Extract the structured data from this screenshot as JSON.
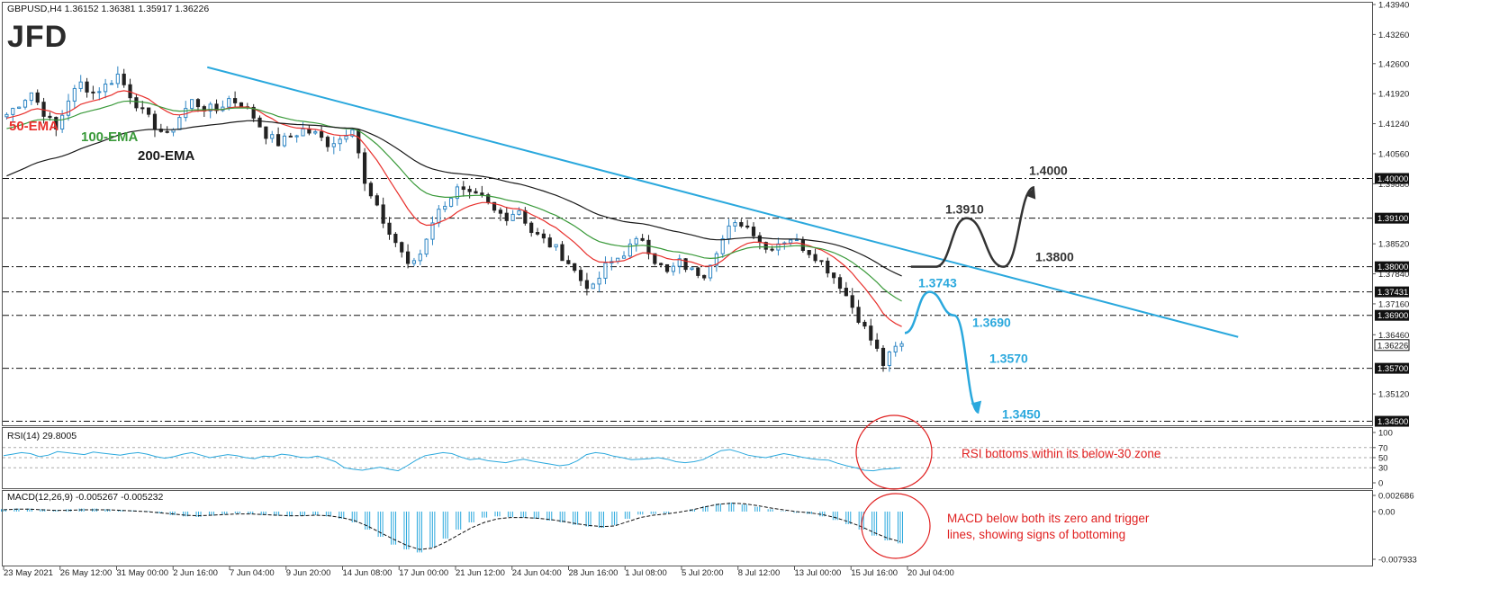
{
  "header": {
    "symbol_info": "GBPUSD,H4  1.36152 1.36381 1.35917 1.36226",
    "logo": "JFD"
  },
  "colors": {
    "bull_candle": "#2f86c4",
    "bear_candle": "#222222",
    "ema50": "#e8302c",
    "ema100": "#3a9a3a",
    "ema200": "#1a1a1a",
    "trendline": "#2aa8dd",
    "level_line": "#111111",
    "scenario_up": "#333333",
    "scenario_down": "#2aa8dd",
    "annotation": "#e02020",
    "rsi_line": "#2aa8dd",
    "macd_hist": "#2aa8dd",
    "macd_signal": "#111111"
  },
  "chart_data": [
    {
      "panel": "price",
      "type": "candlestick",
      "title": "GBPUSD,H4",
      "ylim": [
        1.3445,
        1.4394
      ],
      "price_scale_ticks": [
        "1.43940",
        "1.43260",
        "1.42600",
        "1.41920",
        "1.41240",
        "1.40560",
        "1.39880",
        "1.38520",
        "1.37840",
        "1.37160",
        "1.36460",
        "1.35120"
      ],
      "x_tick_labels": [
        "23 May 2021",
        "26 May 12:00",
        "31 May 00:00",
        "2 Jun 16:00",
        "7 Jun 04:00",
        "9 Jun 20:00",
        "14 Jun 08:00",
        "17 Jun 00:00",
        "21 Jun 12:00",
        "24 Jun 04:00",
        "28 Jun 16:00",
        "1 Jul 08:00",
        "5 Jul 20:00",
        "8 Jul 12:00",
        "13 Jul 00:00",
        "15 Jul 16:00",
        "20 Jul 04:00"
      ],
      "levels": [
        {
          "value": 1.4,
          "axis_label": "1.40000",
          "chart_label": "1.4000"
        },
        {
          "value": 1.391,
          "axis_label": "1.39100",
          "chart_label": "1.3910"
        },
        {
          "value": 1.38,
          "axis_label": "1.38000",
          "chart_label": "1.3800"
        },
        {
          "value": 1.37431,
          "axis_label": "1.37431",
          "chart_label": "1.3743"
        },
        {
          "value": 1.369,
          "axis_label": "1.36900",
          "chart_label": "1.3690"
        },
        {
          "value": 1.357,
          "axis_label": "1.35700",
          "chart_label": "1.3570"
        },
        {
          "value": 1.345,
          "axis_label": "1.34500",
          "chart_label": "1.3450"
        }
      ],
      "current_price": {
        "value": 1.36226,
        "label": "1.36226"
      },
      "ema_labels": {
        "ema50": "50-EMA",
        "ema100": "100-EMA",
        "ema200": "200-EMA"
      },
      "close_path": [
        [
          0,
          1.4145
        ],
        [
          2,
          1.417
        ],
        [
          4,
          1.4195
        ],
        [
          6,
          1.415
        ],
        [
          8,
          1.411
        ],
        [
          10,
          1.418
        ],
        [
          12,
          1.4215
        ],
        [
          14,
          1.4195
        ],
        [
          16,
          1.421
        ],
        [
          18,
          1.4235
        ],
        [
          20,
          1.419
        ],
        [
          22,
          1.415
        ],
        [
          24,
          1.412
        ],
        [
          26,
          1.4095
        ],
        [
          28,
          1.414
        ],
        [
          30,
          1.4175
        ],
        [
          32,
          1.416
        ],
        [
          34,
          1.4155
        ],
        [
          36,
          1.418
        ],
        [
          38,
          1.417
        ],
        [
          40,
          1.414
        ],
        [
          42,
          1.41
        ],
        [
          44,
          1.408
        ],
        [
          46,
          1.4095
        ],
        [
          48,
          1.411
        ],
        [
          50,
          1.41
        ],
        [
          52,
          1.408
        ],
        [
          54,
          1.409
        ],
        [
          56,
          1.412
        ],
        [
          57,
          1.406
        ],
        [
          58,
          1.3985
        ],
        [
          60,
          1.393
        ],
        [
          62,
          1.3875
        ],
        [
          64,
          1.3835
        ],
        [
          65,
          1.38
        ],
        [
          67,
          1.383
        ],
        [
          69,
          1.3905
        ],
        [
          71,
          1.3945
        ],
        [
          73,
          1.3975
        ],
        [
          75,
          1.396
        ],
        [
          77,
          1.3955
        ],
        [
          79,
          1.3925
        ],
        [
          81,
          1.3915
        ],
        [
          83,
          1.393
        ],
        [
          85,
          1.388
        ],
        [
          87,
          1.386
        ],
        [
          89,
          1.384
        ],
        [
          91,
          1.381
        ],
        [
          93,
          1.377
        ],
        [
          95,
          1.375
        ],
        [
          97,
          1.38
        ],
        [
          99,
          1.382
        ],
        [
          101,
          1.3845
        ],
        [
          103,
          1.3865
        ],
        [
          105,
          1.3815
        ],
        [
          107,
          1.3785
        ],
        [
          109,
          1.381
        ],
        [
          111,
          1.379
        ],
        [
          113,
          1.3785
        ],
        [
          115,
          1.384
        ],
        [
          117,
          1.3885
        ],
        [
          119,
          1.39
        ],
        [
          121,
          1.388
        ],
        [
          123,
          1.384
        ],
        [
          125,
          1.3855
        ],
        [
          127,
          1.3865
        ],
        [
          129,
          1.3845
        ],
        [
          131,
          1.3825
        ],
        [
          133,
          1.3795
        ],
        [
          135,
          1.376
        ],
        [
          137,
          1.371
        ],
        [
          139,
          1.366
        ],
        [
          141,
          1.361
        ],
        [
          142,
          1.358
        ],
        [
          144,
          1.3615
        ],
        [
          145,
          1.36226
        ]
      ],
      "scenarios": [
        {
          "name": "bullish",
          "path": [
            [
              147,
              1.38
            ],
            [
              151,
              1.38
            ],
            [
              156,
              1.391
            ],
            [
              162,
              1.38
            ],
            [
              167,
              1.398
            ]
          ]
        },
        {
          "name": "bearish",
          "path": [
            [
              146,
              1.365
            ],
            [
              150,
              1.3743
            ],
            [
              154,
              1.369
            ],
            [
              158,
              1.347
            ]
          ]
        }
      ]
    },
    {
      "panel": "rsi",
      "type": "line",
      "title": "RSI(14) 29.8005",
      "ylim": [
        0,
        100
      ],
      "y_ticks": [
        "100",
        "70",
        "50",
        "30",
        "0"
      ],
      "levels": [
        70,
        50,
        30
      ],
      "values": [
        54,
        57,
        60,
        58,
        52,
        55,
        62,
        60,
        58,
        56,
        61,
        59,
        57,
        55,
        58,
        60,
        57,
        52,
        49,
        52,
        57,
        60,
        55,
        50,
        53,
        56,
        54,
        50,
        48,
        53,
        52,
        57,
        55,
        51,
        50,
        53,
        48,
        42,
        30,
        27,
        25,
        28,
        31,
        27,
        24,
        34,
        45,
        54,
        57,
        60,
        58,
        51,
        46,
        48,
        44,
        42,
        40,
        44,
        47,
        43,
        40,
        37,
        34,
        36,
        44,
        56,
        60,
        58,
        53,
        50,
        46,
        47,
        48,
        50,
        47,
        42,
        40,
        42,
        46,
        55,
        64,
        66,
        61,
        55,
        52,
        50,
        54,
        58,
        55,
        51,
        48,
        46,
        45,
        39,
        34,
        30,
        25,
        24,
        27,
        28,
        30
      ],
      "annotation": "RSI bottoms within its below-30 zone"
    },
    {
      "panel": "macd",
      "type": "histogram",
      "title": "MACD(12,26,9) -0.005267 -0.005232",
      "ylim": [
        -0.007933,
        0.002686
      ],
      "y_ticks": [
        "0.002686",
        "0.00",
        "-0.007933"
      ],
      "histogram": [
        0.0004,
        0.0005,
        0.0005,
        0.0004,
        0.0003,
        0.0004,
        0.0005,
        0.0005,
        0.0004,
        0.0003,
        0.0002,
        0.0001,
        -0.0003,
        -0.0006,
        -0.0008,
        -0.0009,
        -0.0007,
        -0.0005,
        -0.0003,
        -0.0004,
        -0.0006,
        -0.0007,
        -0.0008,
        -0.0007,
        -0.0006,
        -0.0008,
        -0.0012,
        -0.0018,
        -0.003,
        -0.0042,
        -0.0055,
        -0.0063,
        -0.0068,
        -0.006,
        -0.0045,
        -0.003,
        -0.0018,
        -0.001,
        -0.0008,
        -0.0009,
        -0.001,
        -0.0012,
        -0.0015,
        -0.0018,
        -0.0022,
        -0.0025,
        -0.0027,
        -0.0023,
        -0.0012,
        -0.0005,
        -0.0004,
        -0.0003,
        0.0,
        0.0004,
        0.0009,
        0.0013,
        0.0015,
        0.0012,
        0.0008,
        0.0004,
        0.0001,
        -0.0002,
        -0.0004,
        -0.0008,
        -0.0014,
        -0.0021,
        -0.003,
        -0.004,
        -0.0048,
        -0.0053
      ],
      "signal": [
        0.0003,
        0.0004,
        0.0004,
        0.0003,
        0.0002,
        0.0002,
        0.0003,
        0.0003,
        0.0003,
        0.0002,
        0.0001,
        0.0,
        -0.0002,
        -0.0004,
        -0.0006,
        -0.0007,
        -0.0006,
        -0.0005,
        -0.0004,
        -0.0004,
        -0.0005,
        -0.0006,
        -0.0007,
        -0.0007,
        -0.0006,
        -0.0007,
        -0.001,
        -0.0015,
        -0.0024,
        -0.0035,
        -0.0046,
        -0.0056,
        -0.0063,
        -0.0061,
        -0.0051,
        -0.0039,
        -0.0027,
        -0.0018,
        -0.0012,
        -0.001,
        -0.001,
        -0.0011,
        -0.0013,
        -0.0016,
        -0.002,
        -0.0023,
        -0.0025,
        -0.0024,
        -0.0017,
        -0.001,
        -0.0006,
        -0.0004,
        -0.0001,
        0.0003,
        0.0008,
        0.0012,
        0.0014,
        0.0013,
        0.001,
        0.0006,
        0.0003,
        0.0,
        -0.0002,
        -0.0005,
        -0.001,
        -0.0017,
        -0.0025,
        -0.0035,
        -0.0044,
        -0.005
      ],
      "annotation_line1": "MACD below both its zero and trigger",
      "annotation_line2": "lines, showing signs of bottoming"
    }
  ]
}
